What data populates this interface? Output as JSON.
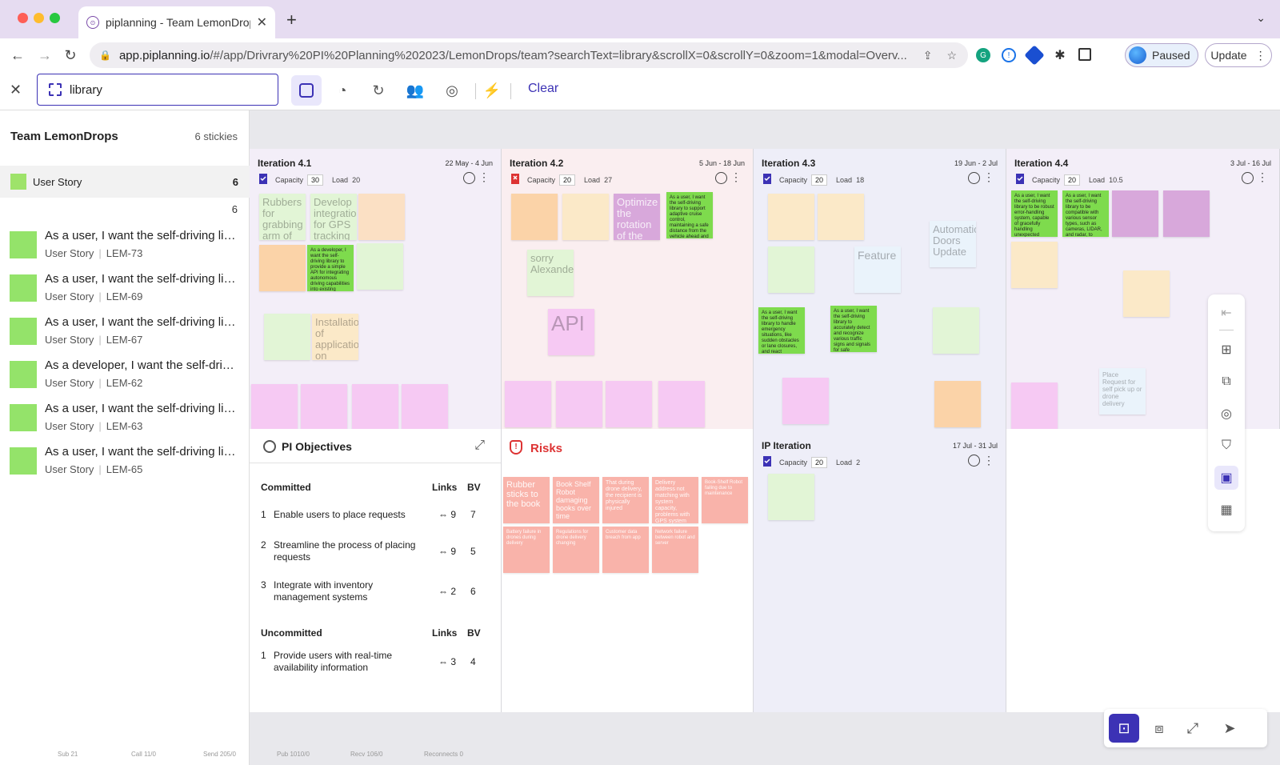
{
  "browser": {
    "tab_title": "piplanning - Team LemonDrops",
    "url_host": "app.piplanning.io",
    "url_path": "/#/app/Drivrary%20PI%20Planning%202023/LemonDrops/team?searchText=library&scrollX=0&scrollY=0&zoom=1&modal=Overv...",
    "profile_label": "Paused",
    "update_label": "Update"
  },
  "toolbar": {
    "search_value": "library",
    "clear_label": "Clear"
  },
  "sidebar": {
    "team_name": "Team LemonDrops",
    "sticky_count": "6 stickies",
    "type_label": "User Story",
    "type_count": "6",
    "sub_count": "6",
    "items": [
      {
        "title": "As a user, I want the self-driving library to",
        "type": "User Story",
        "key": "LEM-73"
      },
      {
        "title": "As a user, I want the self-driving library to",
        "type": "User Story",
        "key": "LEM-69"
      },
      {
        "title": "As a user, I want the self-driving library to",
        "type": "User Story",
        "key": "LEM-67"
      },
      {
        "title": "As a developer, I want the self-driving library",
        "type": "User Story",
        "key": "LEM-62"
      },
      {
        "title": "As a user, I want the self-driving library to",
        "type": "User Story",
        "key": "LEM-63"
      },
      {
        "title": "As a user, I want the self-driving library to",
        "type": "User Story",
        "key": "LEM-65"
      }
    ],
    "stats": [
      "Sub 21",
      "Call 11/0",
      "Send 205/0"
    ]
  },
  "board_stats": [
    "Pub 1010/0",
    "Recv 106/0",
    "Reconnects 0"
  ],
  "iterations": [
    {
      "name": "Iteration 4.1",
      "dates": "22 May - 4 Jun",
      "capacity_label": "Capacity",
      "capacity": "30",
      "load_label": "Load",
      "load": "20"
    },
    {
      "name": "Iteration 4.2",
      "dates": "5 Jun - 18 Jun",
      "capacity_label": "Capacity",
      "capacity": "20",
      "load_label": "Load",
      "load": "27"
    },
    {
      "name": "Iteration 4.3",
      "dates": "19 Jun - 2 Jul",
      "capacity_label": "Capacity",
      "capacity": "20",
      "load_label": "Load",
      "load": "18"
    },
    {
      "name": "Iteration 4.4",
      "dates": "3 Jul - 16 Jul",
      "capacity_label": "Capacity",
      "capacity": "20",
      "load_label": "Load",
      "load": "10.5"
    }
  ],
  "ip_iteration": {
    "name": "IP Iteration",
    "dates": "17 Jul - 31 Jul",
    "capacity_label": "Capacity",
    "capacity": "20",
    "load_label": "Load",
    "load": "2"
  },
  "notes": {
    "rubbers": "Rubbers for grabbing arm of Book Shelf Robot",
    "gps": "Develop integration for GPS tracking",
    "installation": "Installation of application on Windows",
    "optimize": "Optimize the rotation of the deliver arm",
    "sorry": "sorry Alexander",
    "api": "API",
    "auto_doors": "Automatic Doors Update",
    "feature": "Feature",
    "place_request": "Place Request for self pick up or drone delivery",
    "dev_libs": "As a developer, I want the self-driving library to provide a simple API for integrating autonomous driving capabilities into existing vehicles.",
    "weather": "As a user, I want the self-driving library to support adaptive cruise control, maintaining a safe distance from the vehicle ahead and adjusting speed accordingly.",
    "emergency": "As a user, I want the self-driving library to handle emergency situations, like sudden obstacles or lane closures, and react appropriately.",
    "traffic_signs": "As a user, I want the self-driving library to accurately detect and recognize various traffic signs and signals for safe navigation.",
    "handling": "As a user, I want the self-driving library to be robust error-handling system, capable of gracefully handling unexpected exceptions and recovering from failures.",
    "pedestrians": "As a user, I want the self-driving library to be compatible with various sensor types, such as cameras, LIDAR, and radar, to ensure a comprehensive perception of the environment."
  },
  "objectives": {
    "title": "PI Objectives",
    "committed_label": "Committed",
    "uncommitted_label": "Uncommitted",
    "links_label": "Links",
    "bv_label": "BV",
    "committed": [
      {
        "num": "1",
        "text": "Enable users to place requests",
        "links": "9",
        "bv": "7"
      },
      {
        "num": "2",
        "text": "Streamline the process of placing requests",
        "links": "9",
        "bv": "5"
      },
      {
        "num": "3",
        "text": "Integrate with inventory management systems",
        "links": "2",
        "bv": "6"
      }
    ],
    "uncommitted": [
      {
        "num": "1",
        "text": "Provide users with real-time availability information",
        "links": "3",
        "bv": "4"
      }
    ]
  },
  "risks": {
    "title": "Risks",
    "items": [
      "Rubber sticks to the book",
      "Book Shelf Robot damaging books over time",
      "That during drone delivery, the recipient is physically injured",
      "Delivery address not matching with system capacity, problems with GPS system",
      "Book-Shelf Robot failing due to maintenance",
      "Battery failure in drones during delivery",
      "Regulations for drone delivery changing",
      "Customer data breach from app",
      "Network failure between robot and server"
    ]
  },
  "colors": {
    "accent": "#3c32b5",
    "user_story": "#94e36a",
    "risk": "#f9b3aa"
  }
}
